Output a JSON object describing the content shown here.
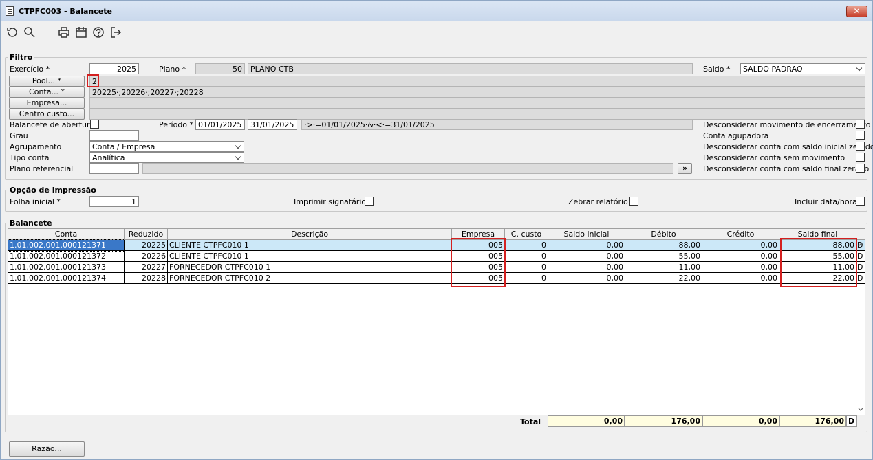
{
  "window": {
    "title": "CTPFC003 - Balancete",
    "close_label": "✕"
  },
  "toolbar": {
    "icons": [
      "undo-icon",
      "search-icon",
      "print-icon",
      "calendar-icon",
      "help-icon",
      "exit-icon"
    ]
  },
  "filtro": {
    "group_title": "Filtro",
    "exercicio_label": "Exercício *",
    "exercicio_value": "2025",
    "plano_label": "Plano *",
    "plano_code": "50",
    "plano_name": "PLANO CTB",
    "saldo_label": "Saldo *",
    "saldo_value": "SALDO PADRAO",
    "pool_button": "Pool... *",
    "pool_value": "2",
    "conta_button": "Conta... *",
    "conta_value": "20225·;20226·;20227·;20228",
    "empresa_button": "Empresa...",
    "empresa_value": "",
    "centro_button": "Centro custo...",
    "centro_value": "",
    "abertura_label": "Balancete de abertura",
    "periodo_label": "Período *",
    "periodo_ini": "01/01/2025",
    "periodo_fim": "31/01/2025",
    "periodo_expr": "·>·=01/01/2025·&·<·=31/01/2025",
    "grau_label": "Grau",
    "grau_value": "",
    "agrupamento_label": "Agrupamento",
    "agrupamento_value": "Conta / Empresa",
    "tipo_label": "Tipo conta",
    "tipo_value": "Analítica",
    "plano_ref_label": "Plano referencial",
    "plano_ref_value": "",
    "plano_ref_btn": "»",
    "opt_encerramento": "Desconsiderar movimento de encerramento",
    "opt_agrupadora": "Conta agupadora",
    "opt_inicial_zerado": "Desconsiderar conta com saldo inicial zerado",
    "opt_sem_mov": "Desconsiderar conta sem movimento",
    "opt_final_zerado": "Desconsiderar conta com saldo final zerado"
  },
  "impressao": {
    "group_title": "Opção de impressão",
    "folha_label": "Folha inicial *",
    "folha_value": "1",
    "signatario_label": "Imprimir signatário",
    "zebrar_label": "Zebrar relatório",
    "data_hora_label": "Incluir data/hora"
  },
  "balancete": {
    "group_title": "Balancete",
    "columns": [
      "Conta",
      "Reduzido",
      "Descrição",
      "Empresa",
      "C. custo",
      "Saldo inicial",
      "Débito",
      "Crédito",
      "Saldo final"
    ],
    "rows": [
      {
        "conta": "1.01.002.001.000121371",
        "reduzido": "20225",
        "descricao": "CLIENTE CTPFC010 1",
        "empresa": "005",
        "ccusto": "0",
        "inicial": "0,00",
        "debito": "88,00",
        "credito": "0,00",
        "final": "88,00",
        "dc": "D"
      },
      {
        "conta": "1.01.002.001.000121372",
        "reduzido": "20226",
        "descricao": "CLIENTE CTPFC010 1",
        "empresa": "005",
        "ccusto": "0",
        "inicial": "0,00",
        "debito": "55,00",
        "credito": "0,00",
        "final": "55,00",
        "dc": "D"
      },
      {
        "conta": "1.01.002.001.000121373",
        "reduzido": "20227",
        "descricao": "FORNECEDOR CTPFC010 1",
        "empresa": "005",
        "ccusto": "0",
        "inicial": "0,00",
        "debito": "11,00",
        "credito": "0,00",
        "final": "11,00",
        "dc": "D"
      },
      {
        "conta": "1.01.002.001.000121374",
        "reduzido": "20228",
        "descricao": "FORNECEDOR CTPFC010 2",
        "empresa": "005",
        "ccusto": "0",
        "inicial": "0,00",
        "debito": "22,00",
        "credito": "0,00",
        "final": "22,00",
        "dc": "D"
      }
    ],
    "total_label": "Total",
    "totals": {
      "inicial": "0,00",
      "debito": "176,00",
      "credito": "0,00",
      "final": "176,00",
      "dc": "D"
    }
  },
  "footer": {
    "razao_button": "Razão..."
  }
}
